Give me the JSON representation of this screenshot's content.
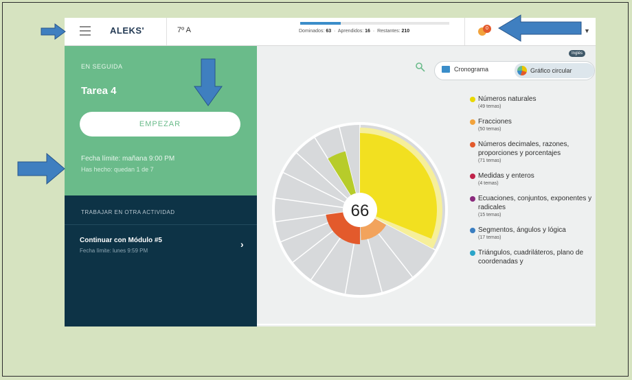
{
  "topbar": {
    "logo": "ALEKS'",
    "class_name": "7º A",
    "stats": {
      "dominados_label": "Dominados:",
      "dominados_value": "63",
      "aprendidos_label": "Aprendidos:",
      "aprendidos_value": "16",
      "restantes_label": "Restantes:",
      "restantes_value": "210"
    },
    "progress_fraction": 0.27,
    "notification_count": "0"
  },
  "left_panel": {
    "status_label": "EN SEGUIDA",
    "task_title": "Tarea 4",
    "start_button": "EMPEZAR",
    "due_line": "Fecha límite: mañana 9:00 PM",
    "due_line2": "Has hecho: quedan 1 de 7",
    "other_activity_label": "TRABAJAR EN OTRA ACTIVIDAD",
    "module_title": "Continuar con Módulo #5",
    "module_due": "Fecha límite: lunes 9:59 PM"
  },
  "right_panel": {
    "badge": "Inglés",
    "toggle_left": "Cronograma",
    "toggle_right": "Gráfico circular",
    "center_value": "66"
  },
  "legend": [
    {
      "name": "Números naturales",
      "sub": "(49 temas)",
      "color": "#e9d800"
    },
    {
      "name": "Fracciones",
      "sub": "(50 temas)",
      "color": "#f2a33c"
    },
    {
      "name": "Números decimales, razones, proporciones y porcentajes",
      "sub": "(71 temas)",
      "color": "#e35a2c"
    },
    {
      "name": "Medidas y enteros",
      "sub": "(4 temas)",
      "color": "#c0234a"
    },
    {
      "name": "Ecuaciones, conjuntos, exponentes y radicales",
      "sub": "(15 temas)",
      "color": "#8a2b7d"
    },
    {
      "name": "Segmentos, ángulos y lógica",
      "sub": "(17 temas)",
      "color": "#3a7ec1"
    },
    {
      "name": "Triángulos, cuadriláteros, plano de coordenadas y",
      "sub": "",
      "color": "#2aa5c9"
    }
  ],
  "colors": {
    "background": "#d6e3c0",
    "panel_green": "#6abb8a",
    "panel_dark": "#0d3346",
    "arrow": "#3f7fc0"
  },
  "icons": [
    "hamburger-icon",
    "notification-icon",
    "chevron-down-icon",
    "search-icon",
    "calendar-icon",
    "pie-chart-icon",
    "chevron-right-icon",
    "arrow-right-icon",
    "arrow-down-icon",
    "arrow-left-icon"
  ]
}
